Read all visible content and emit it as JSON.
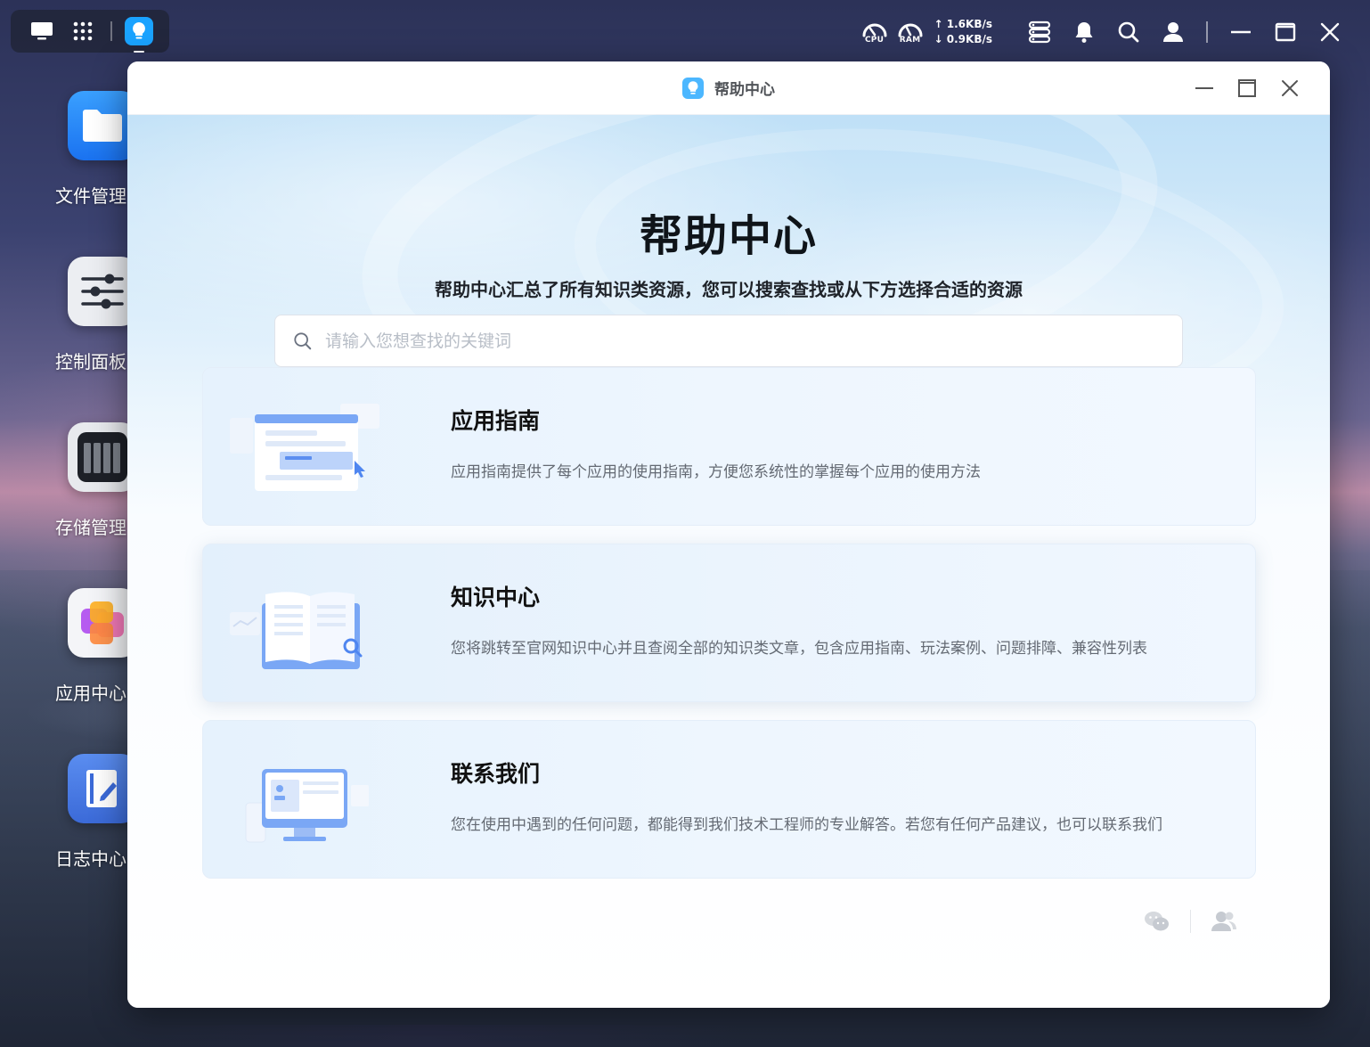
{
  "desktop": {
    "icons": [
      {
        "label": "文件管理",
        "icon": "folder-icon"
      },
      {
        "label": "控制面板",
        "icon": "sliders-icon"
      },
      {
        "label": "存储管理",
        "icon": "storage-icon"
      },
      {
        "label": "应用中心",
        "icon": "app-center-icon"
      },
      {
        "label": "日志中心",
        "icon": "log-icon"
      }
    ]
  },
  "sysbar": {
    "cpu_label": "CPU",
    "ram_label": "RAM",
    "upload": "↑ 1.6KB/s",
    "download": "↓ 0.9KB/s"
  },
  "window": {
    "title": "帮助中心",
    "hero_title": "帮助中心",
    "hero_subtitle": "帮助中心汇总了所有知识类资源，您可以搜索查找或从下方选择合适的资源",
    "search_placeholder": "请输入您想查找的关键词",
    "cards": [
      {
        "title": "应用指南",
        "desc": "应用指南提供了每个应用的使用指南，方便您系统性的掌握每个应用的使用方法"
      },
      {
        "title": "知识中心",
        "desc": "您将跳转至官网知识中心并且查阅全部的知识类文章，包含应用指南、玩法案例、问题排障、兼容性列表"
      },
      {
        "title": "联系我们",
        "desc": "您在使用中遇到的任何问题，都能得到我们技术工程师的专业解答。若您有任何产品建议，也可以联系我们"
      }
    ]
  },
  "colors": {
    "accent": "#1aa3ff",
    "illustration_blue": "#7aa7f5"
  }
}
